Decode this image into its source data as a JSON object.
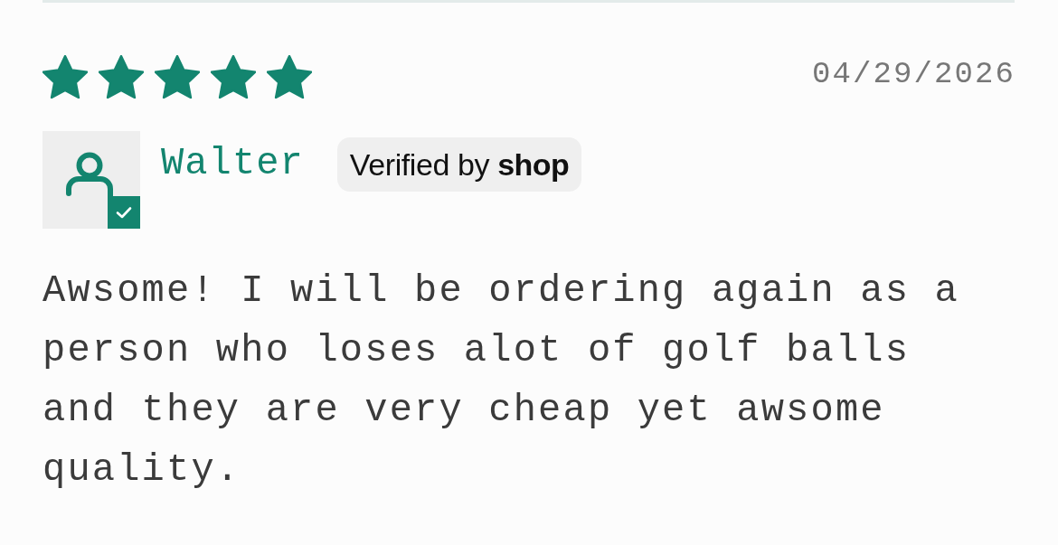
{
  "review": {
    "stars": 5,
    "date": "04/29/2026",
    "reviewer": {
      "name": "Walter",
      "verified": true
    },
    "badge": "Verified by **shop**",
    "body": "Awsome! I will be ordering again as a person who loses alot of golf balls and they are very cheap yet awsome quality."
  }
}
